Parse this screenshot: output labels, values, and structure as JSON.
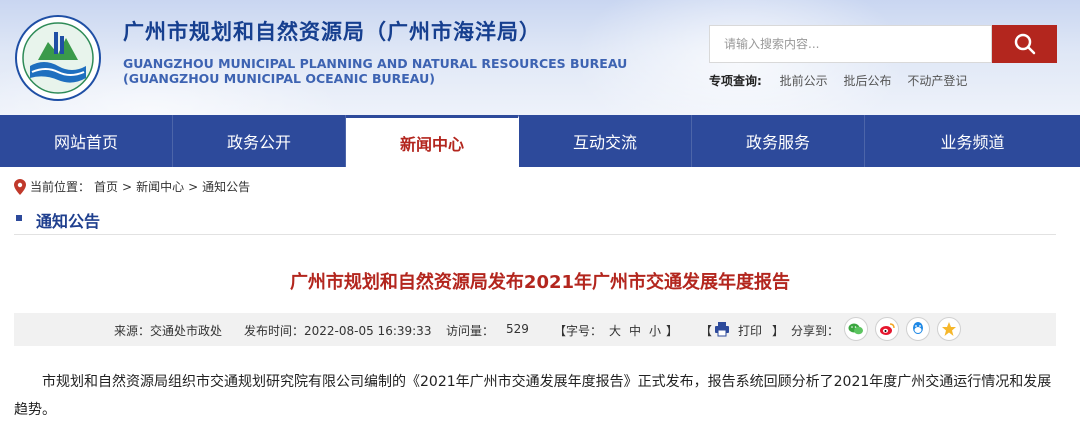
{
  "header": {
    "title_cn": "广州市规划和自然资源局（广州市海洋局）",
    "title_en_1": "GUANGZHOU MUNICIPAL PLANNING AND NATURAL RESOURCES BUREAU",
    "title_en_2": "(GUANGZHOU MUNICIPAL OCEANIC BUREAU)",
    "logo_text": "广州市规划和自然资源局"
  },
  "search": {
    "placeholder": "请输入搜索内容...",
    "button_icon": "search-icon"
  },
  "quick_query": {
    "label": "专项查询:",
    "items": [
      "批前公示",
      "批后公布",
      "不动产登记"
    ]
  },
  "nav": {
    "items": [
      "网站首页",
      "政务公开",
      "新闻中心",
      "互动交流",
      "政务服务",
      "业务频道"
    ],
    "active_index": 2
  },
  "breadcrumb": {
    "prefix": "当前位置：",
    "items": [
      "首页",
      "新闻中心",
      "通知公告"
    ],
    "separator": ">"
  },
  "section": {
    "title": "通知公告"
  },
  "article": {
    "title": "广州市规划和自然资源局发布2021年广州市交通发展年度报告",
    "source": "来源：交通处市政处",
    "publish_time": "发布时间：2022-08-05 16:39:33",
    "visits_label": "访问量：",
    "visits": "529",
    "font_size_label": "【字号：",
    "font_size_options": [
      "大",
      "中",
      "小"
    ],
    "font_size_end": "】",
    "print_open": "【",
    "print_label": "打印",
    "print_close": "】",
    "share_label": "分享到：",
    "share_icons": [
      "wechat-icon",
      "weibo-icon",
      "qq-icon",
      "qzone-icon"
    ],
    "body": "市规划和自然资源局组织市交通规划研究院有限公司编制的《2021年广州市交通发展年度报告》正式发布，报告系统回顾分析了2021年度广州交通运行情况和发展趋势。"
  },
  "colors": {
    "nav_bg": "#2d4a9b",
    "accent_red": "#b3261e",
    "title_blue": "#163f8f"
  }
}
